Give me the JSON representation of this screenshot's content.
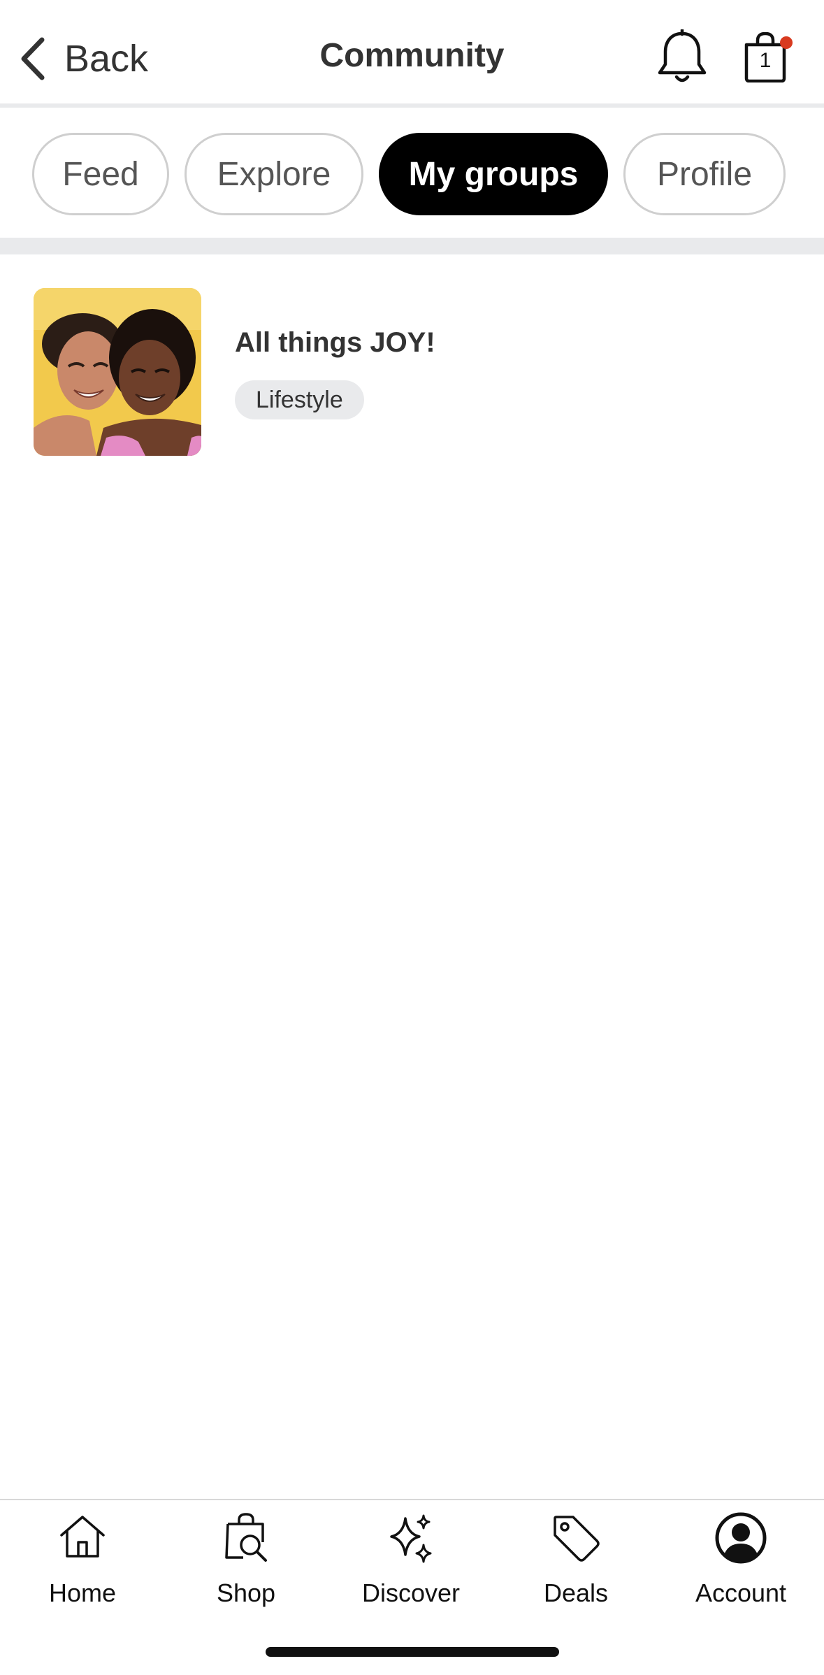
{
  "header": {
    "back_label": "Back",
    "title": "Community",
    "cart_count": "1",
    "notification_icon": "bell-icon",
    "cart_icon": "shopping-bag-icon",
    "cart_dot_color": "#d83a1f"
  },
  "tabs": [
    {
      "label": "Feed",
      "active": false
    },
    {
      "label": "Explore",
      "active": false
    },
    {
      "label": "My groups",
      "active": true
    },
    {
      "label": "Profile",
      "active": false
    }
  ],
  "groups": [
    {
      "name": "All things JOY!",
      "tag": "Lifestyle",
      "thumbnail": "two-smiling-women-photo"
    }
  ],
  "bottom_nav": [
    {
      "label": "Home",
      "icon": "home-icon"
    },
    {
      "label": "Shop",
      "icon": "shop-search-bag-icon"
    },
    {
      "label": "Discover",
      "icon": "sparkles-icon"
    },
    {
      "label": "Deals",
      "icon": "tag-icon"
    },
    {
      "label": "Account",
      "icon": "account-icon"
    }
  ],
  "colors": {
    "active_tab_bg": "#000000",
    "divider": "#e9eaec",
    "tag_bg": "#e9eaec",
    "thumbnail_bg": "#f2c94c"
  }
}
